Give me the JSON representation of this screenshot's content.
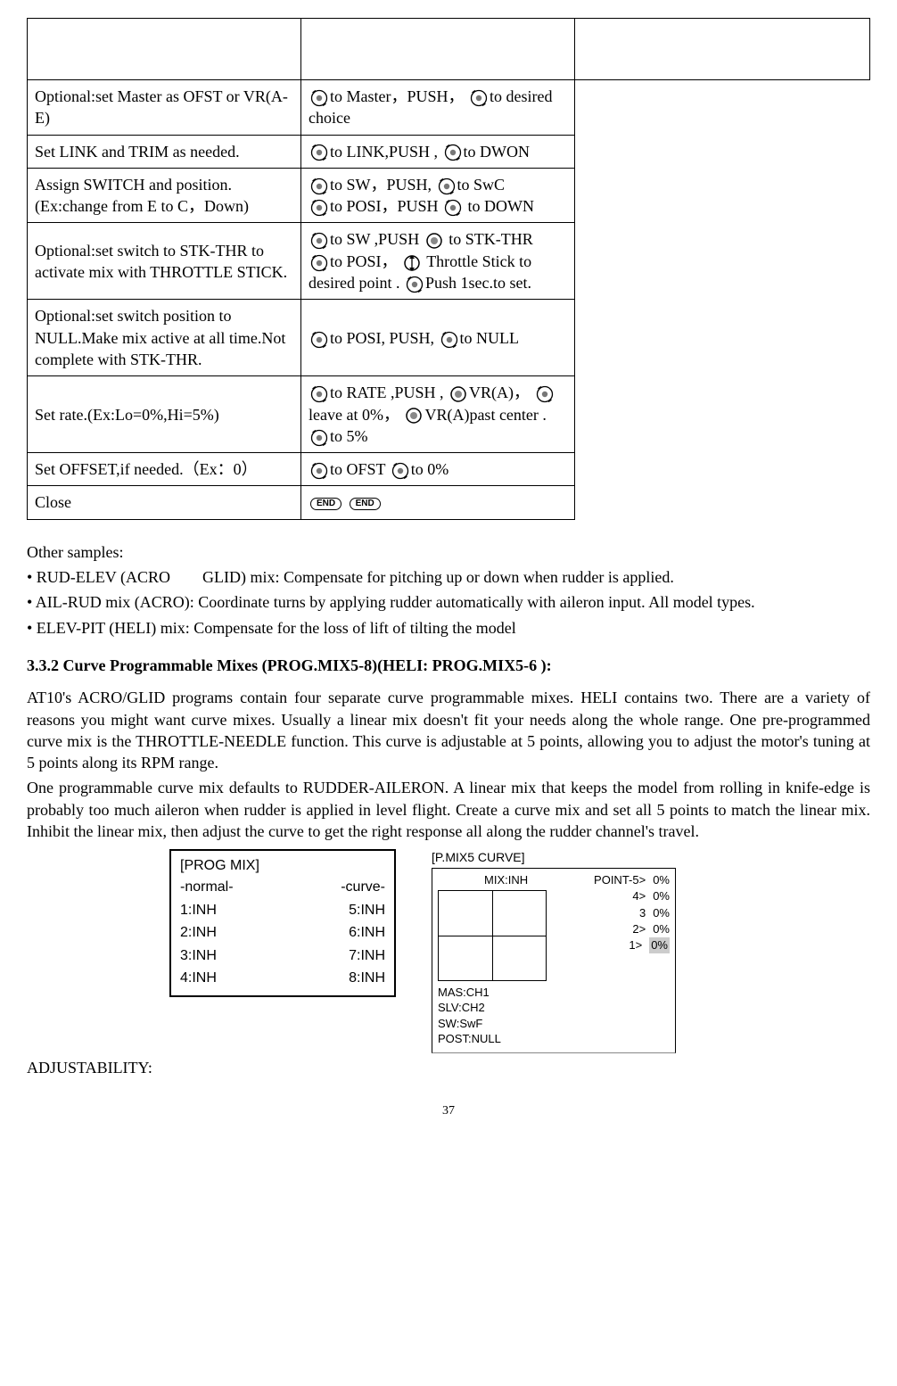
{
  "table": {
    "rows": [
      {
        "left": "Optional:set Master as OFST or VR(A-E)",
        "right": [
          "dial",
          "to Master，PUSH，",
          "dial",
          "to desired choice"
        ]
      },
      {
        "left": "Set LINK and TRIM as needed.",
        "right": [
          "dial",
          "to LINK,PUSH ,",
          "dial",
          "to DWON"
        ]
      },
      {
        "left": "Assign SWITCH and position. (Ex:change from E to C，Down)",
        "right": [
          "dial",
          "to SW，PUSH,",
          "dial",
          "to SwC",
          "br",
          "dial",
          "to POSI，PUSH",
          "dial",
          " to DOWN"
        ]
      },
      {
        "left": "Optional:set switch to STK-THR to activate mix with THROTTLE STICK.",
        "right": [
          "dial",
          "to SW ,PUSH",
          "knob",
          " to STK-THR",
          "br",
          "dial",
          "to POSI，",
          "stick",
          " Throttle Stick to desired point .",
          "dial",
          "Push 1sec.to set."
        ]
      },
      {
        "left": "Optional:set switch position to NULL.Make mix active at all time.Not complete with STK-THR.",
        "right": [
          "dial",
          "to POSI, PUSH,",
          "dial",
          "to NULL"
        ]
      },
      {
        "left": "Set rate.(Ex:Lo=0%,Hi=5%)",
        "right": [
          "dial",
          "to RATE ,PUSH ,",
          "knob",
          "VR(A)，",
          "dial",
          "leave at 0%，",
          "knob",
          "VR(A)past center .",
          "dial",
          "to 5%"
        ]
      },
      {
        "left": "Set OFFSET,if needed.（Ex：0）",
        "right": [
          "dial",
          "to OFST",
          "dial",
          "to 0%"
        ]
      },
      {
        "left": "Close",
        "right": [
          "end",
          "",
          "end",
          ""
        ]
      }
    ]
  },
  "samples": {
    "title": "Other samples:",
    "lines": [
      "• RUD-ELEV (ACRO        GLID) mix: Compensate for pitching up or down when rudder is applied.",
      "• AIL-RUD mix (ACRO): Coordinate turns by applying rudder automatically with aileron input. All model types.",
      "• ELEV-PIT (HELI) mix: Compensate for the loss of lift of tilting the model"
    ]
  },
  "heading": "3.3.2 Curve Programmable Mixes (PROG.MIX5-8)(HELI: PROG.MIX5-6 ):",
  "para": [
    "AT10's ACRO/GLID programs contain four separate curve programmable mixes. HELI contains two. There are a variety of reasons you might want curve mixes. Usually a linear mix doesn't fit your needs along the whole range. One pre-programmed curve mix is the THROTTLE-NEEDLE function. This curve is adjustable at 5 points, allowing you to adjust the motor's tuning at 5 points along its RPM range.",
    "One programmable curve mix defaults to RUDDER-AILERON. A linear mix that keeps the model from rolling in knife-edge is probably too much aileron when rudder is applied in level flight. Create a curve mix and set all 5 points to match the linear mix. Inhibit the linear mix, then adjust the curve to get the right response all along the rudder channel's travel."
  ],
  "screen1": {
    "title": "[PROG MIX]",
    "col1h": "-normal-",
    "col2h": "-curve-",
    "rows": [
      [
        "1:INH",
        "5:INH"
      ],
      [
        "2:INH",
        "6:INH"
      ],
      [
        "3:INH",
        "7:INH"
      ],
      [
        "4:INH",
        "8:INH"
      ]
    ]
  },
  "screen2": {
    "title": "[P.MIX5 CURVE]",
    "mix": "MIX:INH",
    "points": [
      [
        "POINT-5>",
        "0%"
      ],
      [
        "4>",
        "0%"
      ],
      [
        "3",
        "0%"
      ],
      [
        "2>",
        "0%"
      ],
      [
        "1>",
        "0%"
      ]
    ],
    "highlight_idx": 4,
    "footer": [
      "MAS:CH1",
      "SLV:CH2",
      "SW:SwF",
      "POST:NULL"
    ]
  },
  "adjust": "ADJUSTABILITY:",
  "pagenum": "37",
  "endlabel": "END",
  "chart_data": {
    "type": "table",
    "screens": [
      {
        "name": "PROG MIX",
        "columns": [
          "normal",
          "curve"
        ],
        "rows": [
          [
            "1:INH",
            "5:INH"
          ],
          [
            "2:INH",
            "6:INH"
          ],
          [
            "3:INH",
            "7:INH"
          ],
          [
            "4:INH",
            "8:INH"
          ]
        ]
      },
      {
        "name": "P.MIX5 CURVE",
        "mix": "INH",
        "points": {
          "POINT-5": 0,
          "4": 0,
          "3": 0,
          "2": 0,
          "1": 0
        },
        "master": "CH1",
        "slave": "CH2",
        "switch": "SwF",
        "position": "NULL"
      }
    ]
  }
}
